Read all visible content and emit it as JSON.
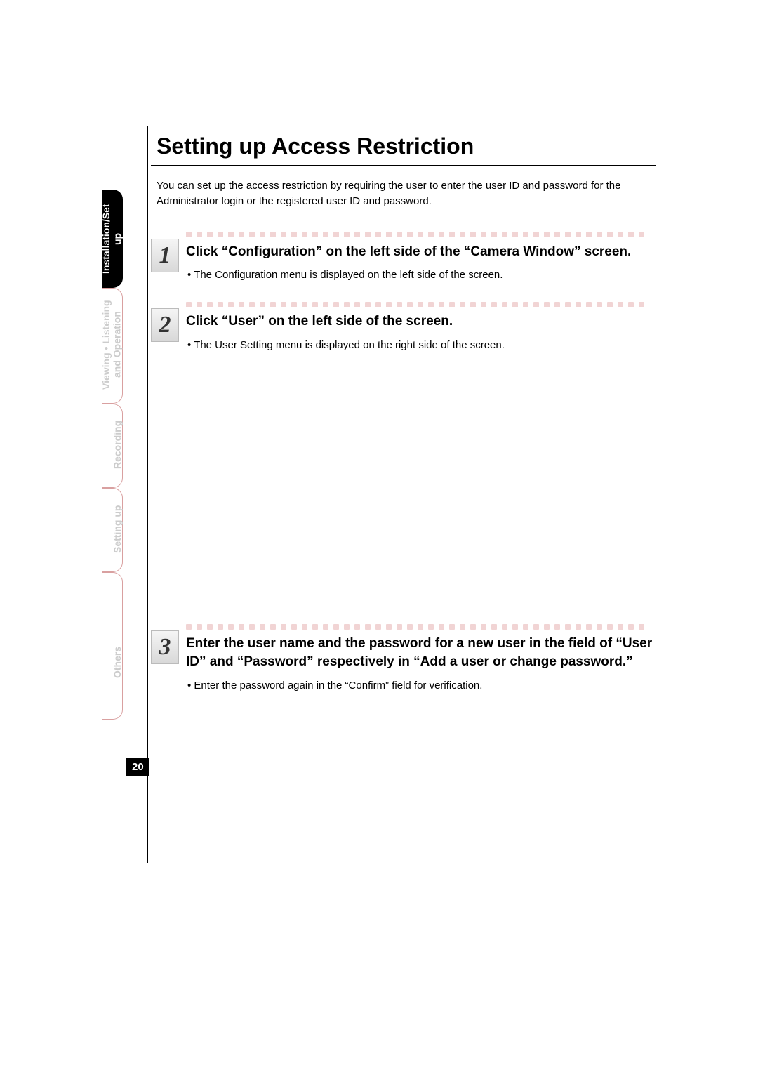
{
  "page_number": "20",
  "title": "Setting up Access Restriction",
  "intro": "You can set up the access restriction by requiring the user to enter the user ID and password for the Administrator login or the registered user ID and password.",
  "tabs": [
    {
      "label": "Installation/Set up",
      "active": true
    },
    {
      "label": "Viewing • Listening and Operation",
      "active": false
    },
    {
      "label": "Recording",
      "active": false
    },
    {
      "label": "Setting up",
      "active": false
    },
    {
      "label": "Others",
      "active": false
    }
  ],
  "steps": [
    {
      "num": "1",
      "heading": "Click “Configuration” on the left side of the “Camera Window” screen.",
      "bullet": "The Configuration menu is displayed on the left side of the screen."
    },
    {
      "num": "2",
      "heading": "Click “User” on the left side of the screen.",
      "bullet": "The User Setting menu is displayed on the right side of the screen."
    },
    {
      "num": "3",
      "heading": "Enter the user name and the password for a new user in the field of “User ID” and “Password” respectively in “Add a user or change password.”",
      "bullet": "Enter the password again in the “Confirm” field for verification."
    }
  ]
}
